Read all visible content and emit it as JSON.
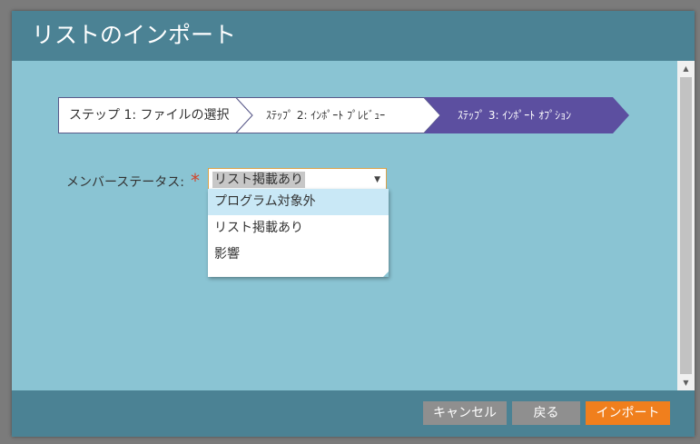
{
  "dialog": {
    "title": "リストのインポート"
  },
  "steps": [
    {
      "label": "ステップ 1: ファイルの選択",
      "state": "done"
    },
    {
      "label": "ｽﾃｯﾌﾟ 2: ｲﾝﾎﾟｰﾄ ﾌﾟﾚﾋﾞｭｰ",
      "state": "done"
    },
    {
      "label": "ｽﾃｯﾌﾟ 3: ｲﾝﾎﾟｰﾄ ｵﾌﾟｼｮﾝ",
      "state": "active"
    }
  ],
  "form": {
    "member_status_label": "メンバーステータス:",
    "required_mark": "*",
    "member_status_value": "リスト掲載あり",
    "options": [
      "プログラム対象外",
      "リスト掲載あり",
      "影響"
    ],
    "hovered_option_index": 0
  },
  "footer": {
    "cancel_label": "キャンセル",
    "back_label": "戻る",
    "import_label": "インポート"
  },
  "colors": {
    "titlebar": "#4b8294",
    "content_bg": "#8ac4d3",
    "active_step": "#5c4fa0",
    "primary_button": "#f07f1d",
    "secondary_button": "#8f8f8f",
    "required": "#d2452b"
  }
}
